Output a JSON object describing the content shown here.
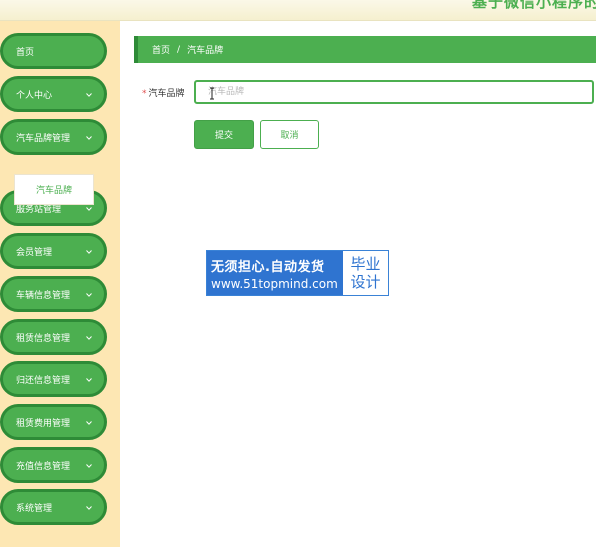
{
  "header": {
    "site_title": "基于微信小程序的"
  },
  "sidebar": {
    "items": [
      {
        "label": "首页",
        "name": "sidebar-item-home",
        "has_chevron": false
      },
      {
        "label": "个人中心",
        "name": "sidebar-item-personal-center",
        "has_chevron": true
      },
      {
        "label": "汽车品牌管理",
        "name": "sidebar-item-car-brand-management",
        "has_chevron": true
      },
      {
        "label": "服务站管理",
        "name": "sidebar-item-service-station-management",
        "has_chevron": true
      },
      {
        "label": "会员管理",
        "name": "sidebar-item-member-management",
        "has_chevron": true
      },
      {
        "label": "车辆信息管理",
        "name": "sidebar-item-vehicle-info-management",
        "has_chevron": true
      },
      {
        "label": "租赁信息管理",
        "name": "sidebar-item-rental-info-management",
        "has_chevron": true
      },
      {
        "label": "归还信息管理",
        "name": "sidebar-item-return-info-management",
        "has_chevron": true
      },
      {
        "label": "租赁费用管理",
        "name": "sidebar-item-rental-fee-management",
        "has_chevron": true
      },
      {
        "label": "充值信息管理",
        "name": "sidebar-item-recharge-info-management",
        "has_chevron": true
      },
      {
        "label": "系统管理",
        "name": "sidebar-item-system-management",
        "has_chevron": true
      }
    ],
    "submenu": {
      "label": "汽车品牌"
    }
  },
  "breadcrumb": {
    "home": "首页",
    "separator": "/",
    "current": "汽车品牌"
  },
  "form": {
    "required_mark": "*",
    "brand_label": "汽车品牌",
    "brand_placeholder": "汽车品牌",
    "brand_value": ""
  },
  "buttons": {
    "submit": "提交",
    "cancel": "取消"
  },
  "watermark": {
    "line1": "无须担心.自动发货",
    "line2": "www.51topmind.com",
    "right_line1": "毕业",
    "right_line2": "设计"
  },
  "colors": {
    "accent": "#4caf50",
    "accent_dark": "#2e8b37",
    "sidebar_bg": "#fde7b3",
    "watermark_blue": "#2f74d0"
  }
}
